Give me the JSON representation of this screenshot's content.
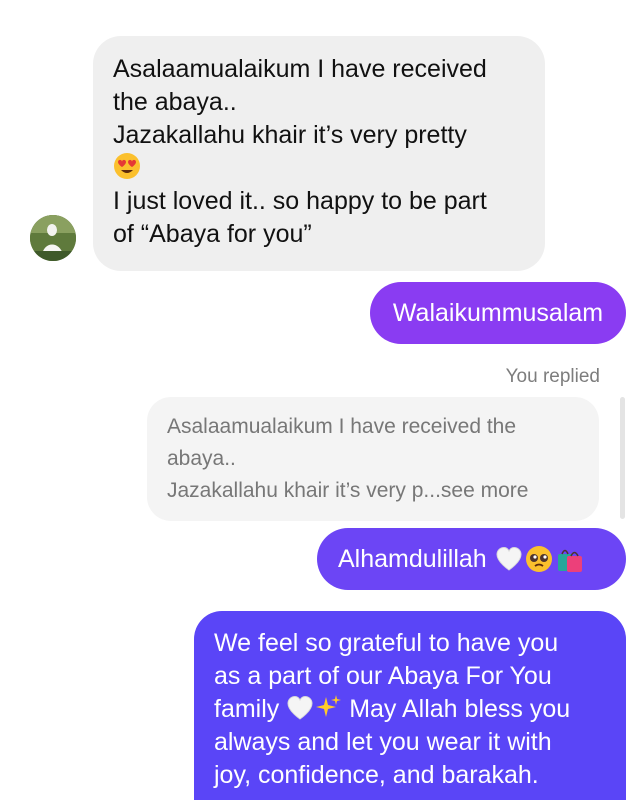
{
  "conversation": {
    "incoming": {
      "lines": [
        "Asalaamualaikum I have received",
        "the abaya..",
        "Jazakallahu khair it’s very pretty",
        "I just loved it.. so happy to be part",
        "of “Abaya for you”"
      ],
      "emoji": "heart-eyes-emoji"
    },
    "outgoing_1": {
      "text": "Walaikummusalam"
    },
    "reply_label": "You replied",
    "reply_quote": {
      "lines": [
        "Asalaamualaikum I have received the",
        "abaya..",
        "Jazakallahu khair it’s very p...see more"
      ]
    },
    "outgoing_2": {
      "text": "Alhamdulillah",
      "emojis": [
        "white-heart-emoji",
        "pleading-face-emoji",
        "shopping-bags-emoji"
      ]
    },
    "outgoing_3": {
      "lines": [
        "We feel so grateful to have you",
        "as a part of our Abaya For You",
        "family",
        "May Allah bless you",
        "always and let you wear it with",
        "joy, confidence, and barakah."
      ]
    }
  },
  "colors": {
    "incoming_bubble": "#efefef",
    "outgoing_bubble_1": "#8a3cf2",
    "outgoing_bubble_2": "#6c45f5",
    "outgoing_bubble_3": "#5a45f7",
    "reply_quote_bg": "#f4f4f4"
  }
}
